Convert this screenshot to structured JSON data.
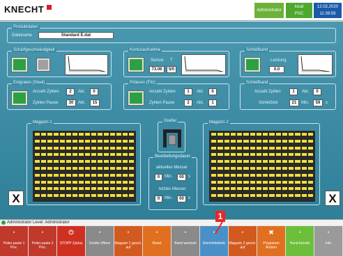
{
  "header": {
    "logo": "KNECHT",
    "user_status": "Administrator",
    "mode_top": "local",
    "mode_bottom": "PVC",
    "date": "12.02.2020",
    "time": "11:39:59",
    "colors": {
      "logo_accent": "#d61f26",
      "status_green": "#4fa82e",
      "clock_blue": "#1a5aa8"
    }
  },
  "product": {
    "legend": "Produktdaten",
    "file_label": "Dateiname",
    "file_value": "Standard E.dat"
  },
  "sections": {
    "schnittgeschw": {
      "legend": "Schärfgeschwindigkeit"
    },
    "kontur": {
      "legend": "Konturaufnahme",
      "sensor_label": "Sensor",
      "t_label": "T",
      "value1": "73.06",
      "value2": "5/0"
    },
    "schleif1": {
      "legend": "Schleifband",
      "leistung_label": "Leistung",
      "leistung_value": "0.0"
    },
    "entgraten": {
      "legend": "Entgraten (Steel)",
      "zyklen_label": "Anzahl Zyklen",
      "zyklen_n": "2",
      "akt_label": "Akt.",
      "zyklen_akt": "0",
      "pause_label": "Zyklen Pause",
      "pause_n": "30",
      "pause_akt_label": "Akt.",
      "pause_akt": "15"
    },
    "polieren": {
      "legend": "Polieren (Filz)",
      "zyklen_label": "Anzahl Zyklen",
      "zyklen_n": "1",
      "akt_label": "Akt.",
      "zyklen_akt": "0",
      "pause_label": "Zyklen Pause",
      "pause_n": "2",
      "pause_akt_label": "Akt.",
      "pause_akt": "1"
    },
    "schleif2": {
      "legend": "Schleifband",
      "zyklen_label": "Anzahl Zyklen",
      "zyklen_n": "1",
      "akt_label": "Akt.",
      "zyklen_akt": "0",
      "zeit_label": "Schleifzeit",
      "zeit_n": "21",
      "min_label": "Min.",
      "zeit_s": "59",
      "s_label": "s"
    }
  },
  "magazines": {
    "left_legend": "Magazin 1",
    "right_legend": "Magazin 2",
    "greifer_legend": "Greifer",
    "rows": 10,
    "cols": 16,
    "slot_color": "#f0e03a"
  },
  "bearbeitung": {
    "legend": "Bearbeitungsdauer",
    "current_label": "aktuelles Messer",
    "current_min": "0",
    "current_min_unit": "Min.",
    "current_s": "00",
    "current_s_unit": "s",
    "last_label": "letztes Messer",
    "last_min": "0",
    "last_min_unit": "Min.",
    "last_s": "00",
    "last_s_unit": "s"
  },
  "side_buttons": {
    "left": "X",
    "right": "X"
  },
  "userbar": {
    "text": "Administrator  Level: Administrator"
  },
  "toolbar": [
    {
      "label": "Polier-paste 1 Pos.",
      "color": "#c0392b",
      "icon": "·"
    },
    {
      "label": "Polier-paste 2 Pos.",
      "color": "#c0392b",
      "icon": "·"
    },
    {
      "label": "STOPP Zyklus",
      "color": "#d03020",
      "icon": "⏻"
    },
    {
      "label": "Greifer öffnen",
      "color": "#8a8a8a",
      "icon": "·"
    },
    {
      "label": "Magazin 1 gesch. auf",
      "color": "#d35a1f",
      "icon": "·"
    },
    {
      "label": "Reset",
      "color": "#e07020",
      "icon": "·"
    },
    {
      "label": "Band wechsel",
      "color": "#8a8a8a",
      "icon": "·"
    },
    {
      "label": "Einrichtbetrieb",
      "color": "#4a90c8",
      "icon": "·"
    },
    {
      "label": "Magazin 2 gesch. auf",
      "color": "#d35a1f",
      "icon": "·"
    },
    {
      "label": "Programm Ändern",
      "color": "#e07020",
      "icon": "✖"
    },
    {
      "label": "Hand betrieb",
      "color": "#6cbf3a",
      "icon": "·"
    },
    {
      "label": "Info",
      "color": "#9a9a9a",
      "icon": "·"
    }
  ],
  "marker": {
    "number": "1"
  }
}
